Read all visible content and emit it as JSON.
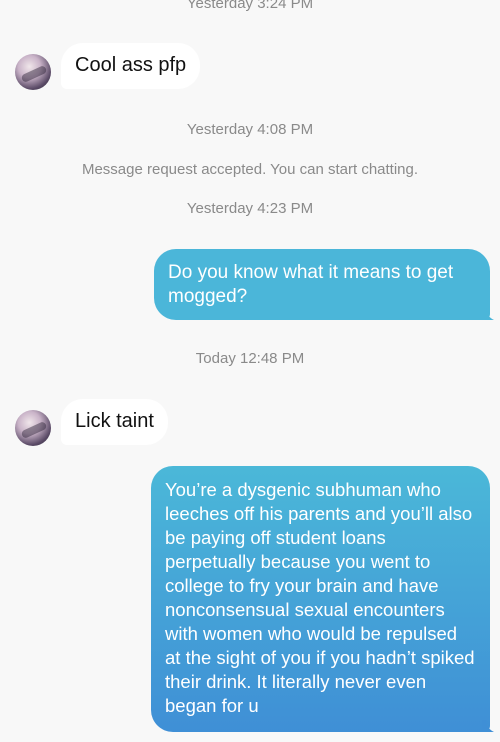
{
  "conversation": {
    "timestamps": [
      "Yesterday 3:24 PM",
      "Yesterday 4:08 PM",
      "Yesterday 4:23 PM",
      "Today 12:48 PM"
    ],
    "system_message": "Message request accepted. You can start chatting.",
    "messages": [
      {
        "direction": "incoming",
        "text": "Cool ass pfp"
      },
      {
        "direction": "outgoing",
        "text": "Do you know what it means to get mogged?"
      },
      {
        "direction": "incoming",
        "text": "Lick taint"
      },
      {
        "direction": "outgoing",
        "text": "You’re a dysgenic subhuman who leeches off his parents and you’ll also be paying off student loans perpetually because you went to college to fry your brain and have nonconsensual sexual encounters with women who would be repulsed at the sight of you if you hadn’t spiked their drink. It literally never even began for u"
      }
    ]
  },
  "colors": {
    "background": "#f8f8f8",
    "incoming_bubble": "#ffffff",
    "outgoing_top": "#4bb8d8",
    "outgoing_bottom": "#3f8fd6",
    "meta_text": "#8a8a8a"
  }
}
